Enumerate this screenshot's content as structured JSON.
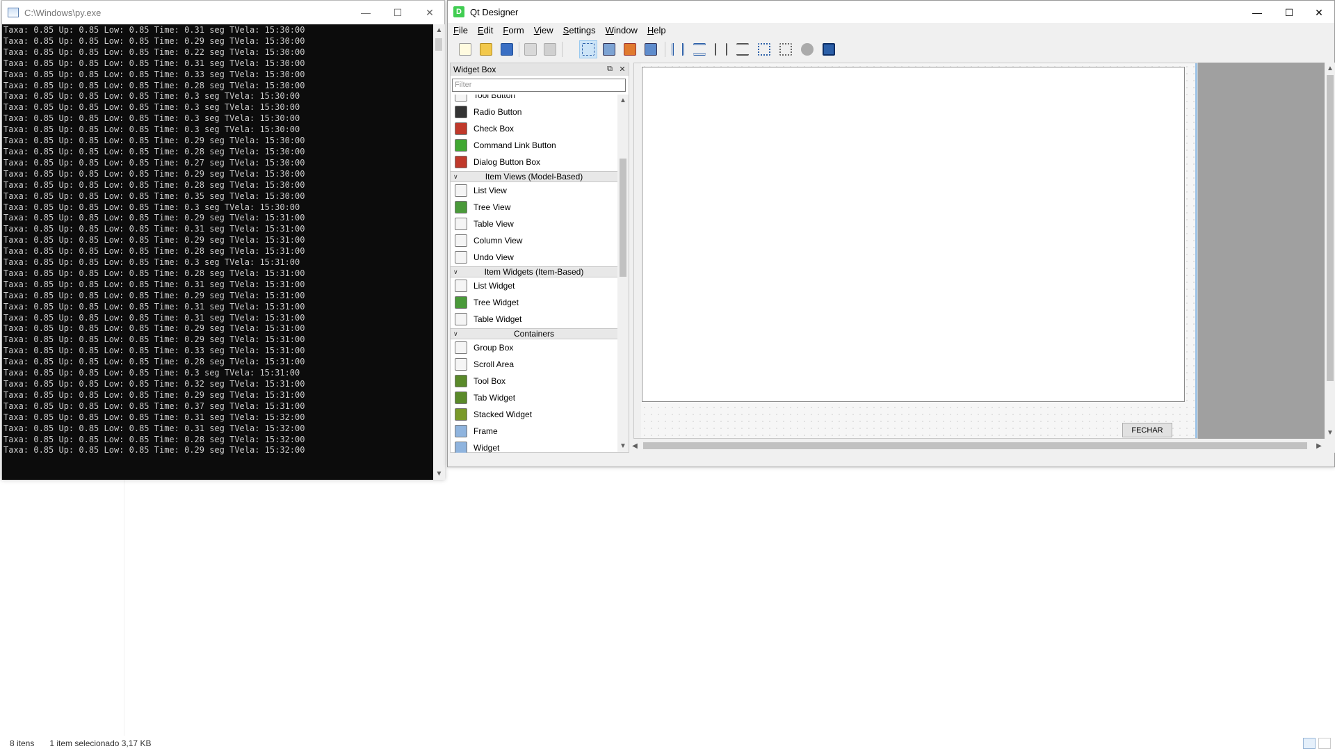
{
  "console": {
    "title": "C:\\Windows\\py.exe",
    "lines": [
      "Taxa: 0.85 Up: 0.85 Low: 0.85 Time: 0.31 seg TVela: 15:30:00",
      "Taxa: 0.85 Up: 0.85 Low: 0.85 Time: 0.29 seg TVela: 15:30:00",
      "Taxa: 0.85 Up: 0.85 Low: 0.85 Time: 0.22 seg TVela: 15:30:00",
      "Taxa: 0.85 Up: 0.85 Low: 0.85 Time: 0.31 seg TVela: 15:30:00",
      "Taxa: 0.85 Up: 0.85 Low: 0.85 Time: 0.33 seg TVela: 15:30:00",
      "Taxa: 0.85 Up: 0.85 Low: 0.85 Time: 0.28 seg TVela: 15:30:00",
      "Taxa: 0.85 Up: 0.85 Low: 0.85 Time: 0.3 seg TVela: 15:30:00",
      "Taxa: 0.85 Up: 0.85 Low: 0.85 Time: 0.3 seg TVela: 15:30:00",
      "Taxa: 0.85 Up: 0.85 Low: 0.85 Time: 0.3 seg TVela: 15:30:00",
      "Taxa: 0.85 Up: 0.85 Low: 0.85 Time: 0.3 seg TVela: 15:30:00",
      "Taxa: 0.85 Up: 0.85 Low: 0.85 Time: 0.29 seg TVela: 15:30:00",
      "Taxa: 0.85 Up: 0.85 Low: 0.85 Time: 0.28 seg TVela: 15:30:00",
      "Taxa: 0.85 Up: 0.85 Low: 0.85 Time: 0.27 seg TVela: 15:30:00",
      "Taxa: 0.85 Up: 0.85 Low: 0.85 Time: 0.29 seg TVela: 15:30:00",
      "Taxa: 0.85 Up: 0.85 Low: 0.85 Time: 0.28 seg TVela: 15:30:00",
      "Taxa: 0.85 Up: 0.85 Low: 0.85 Time: 0.35 seg TVela: 15:30:00",
      "Taxa: 0.85 Up: 0.85 Low: 0.85 Time: 0.3 seg TVela: 15:30:00",
      "Taxa: 0.85 Up: 0.85 Low: 0.85 Time: 0.29 seg TVela: 15:31:00",
      "Taxa: 0.85 Up: 0.85 Low: 0.85 Time: 0.31 seg TVela: 15:31:00",
      "Taxa: 0.85 Up: 0.85 Low: 0.85 Time: 0.29 seg TVela: 15:31:00",
      "Taxa: 0.85 Up: 0.85 Low: 0.85 Time: 0.28 seg TVela: 15:31:00",
      "Taxa: 0.85 Up: 0.85 Low: 0.85 Time: 0.3 seg TVela: 15:31:00",
      "Taxa: 0.85 Up: 0.85 Low: 0.85 Time: 0.28 seg TVela: 15:31:00",
      "Taxa: 0.85 Up: 0.85 Low: 0.85 Time: 0.31 seg TVela: 15:31:00",
      "Taxa: 0.85 Up: 0.85 Low: 0.85 Time: 0.29 seg TVela: 15:31:00",
      "Taxa: 0.85 Up: 0.85 Low: 0.85 Time: 0.31 seg TVela: 15:31:00",
      "Taxa: 0.85 Up: 0.85 Low: 0.85 Time: 0.31 seg TVela: 15:31:00",
      "Taxa: 0.85 Up: 0.85 Low: 0.85 Time: 0.29 seg TVela: 15:31:00",
      "Taxa: 0.85 Up: 0.85 Low: 0.85 Time: 0.29 seg TVela: 15:31:00",
      "Taxa: 0.85 Up: 0.85 Low: 0.85 Time: 0.33 seg TVela: 15:31:00",
      "Taxa: 0.85 Up: 0.85 Low: 0.85 Time: 0.28 seg TVela: 15:31:00",
      "Taxa: 0.85 Up: 0.85 Low: 0.85 Time: 0.3 seg TVela: 15:31:00",
      "Taxa: 0.85 Up: 0.85 Low: 0.85 Time: 0.32 seg TVela: 15:31:00",
      "Taxa: 0.85 Up: 0.85 Low: 0.85 Time: 0.29 seg TVela: 15:31:00",
      "Taxa: 0.85 Up: 0.85 Low: 0.85 Time: 0.37 seg TVela: 15:31:00",
      "Taxa: 0.85 Up: 0.85 Low: 0.85 Time: 0.31 seg TVela: 15:32:00",
      "Taxa: 0.85 Up: 0.85 Low: 0.85 Time: 0.31 seg TVela: 15:32:00",
      "Taxa: 0.85 Up: 0.85 Low: 0.85 Time: 0.28 seg TVela: 15:32:00",
      "Taxa: 0.85 Up: 0.85 Low: 0.85 Time: 0.29 seg TVela: 15:32:00"
    ]
  },
  "designer": {
    "title": "Qt Designer",
    "icon_letter": "D",
    "menus": [
      "File",
      "Edit",
      "Form",
      "View",
      "Settings",
      "Window",
      "Help"
    ],
    "widget_box": {
      "title": "Widget Box",
      "filter_placeholder": "Filter",
      "partial_item": "Tool Button",
      "items": [
        {
          "type": "item",
          "label": "Radio Button",
          "icon": "radio-button-icon"
        },
        {
          "type": "item",
          "label": "Check Box",
          "icon": "check-box-icon"
        },
        {
          "type": "item",
          "label": "Command Link Button",
          "icon": "command-link-icon"
        },
        {
          "type": "item",
          "label": "Dialog Button Box",
          "icon": "dialog-button-box-icon"
        },
        {
          "type": "category",
          "label": "Item Views (Model-Based)"
        },
        {
          "type": "item",
          "label": "List View",
          "icon": "list-view-icon"
        },
        {
          "type": "item",
          "label": "Tree View",
          "icon": "tree-view-icon"
        },
        {
          "type": "item",
          "label": "Table View",
          "icon": "table-view-icon"
        },
        {
          "type": "item",
          "label": "Column View",
          "icon": "column-view-icon"
        },
        {
          "type": "item",
          "label": "Undo View",
          "icon": "undo-view-icon"
        },
        {
          "type": "category",
          "label": "Item Widgets (Item-Based)"
        },
        {
          "type": "item",
          "label": "List Widget",
          "icon": "list-widget-icon"
        },
        {
          "type": "item",
          "label": "Tree Widget",
          "icon": "tree-widget-icon"
        },
        {
          "type": "item",
          "label": "Table Widget",
          "icon": "table-widget-icon"
        },
        {
          "type": "category",
          "label": "Containers"
        },
        {
          "type": "item",
          "label": "Group Box",
          "icon": "group-box-icon"
        },
        {
          "type": "item",
          "label": "Scroll Area",
          "icon": "scroll-area-icon"
        },
        {
          "type": "item",
          "label": "Tool Box",
          "icon": "tool-box-icon"
        },
        {
          "type": "item",
          "label": "Tab Widget",
          "icon": "tab-widget-icon"
        },
        {
          "type": "item",
          "label": "Stacked Widget",
          "icon": "stacked-widget-icon"
        },
        {
          "type": "item",
          "label": "Frame",
          "icon": "frame-icon"
        },
        {
          "type": "item",
          "label": "Widget",
          "icon": "widget-icon"
        }
      ]
    },
    "form": {
      "close_button_label": "FECHAR"
    }
  },
  "explorer_status": {
    "items": "8 itens",
    "selection": "1 item selecionado  3,17 KB"
  },
  "colors": {
    "qt_green": "#41cd52",
    "console_bg": "#0c0c0c",
    "console_fg": "#cccccc"
  }
}
